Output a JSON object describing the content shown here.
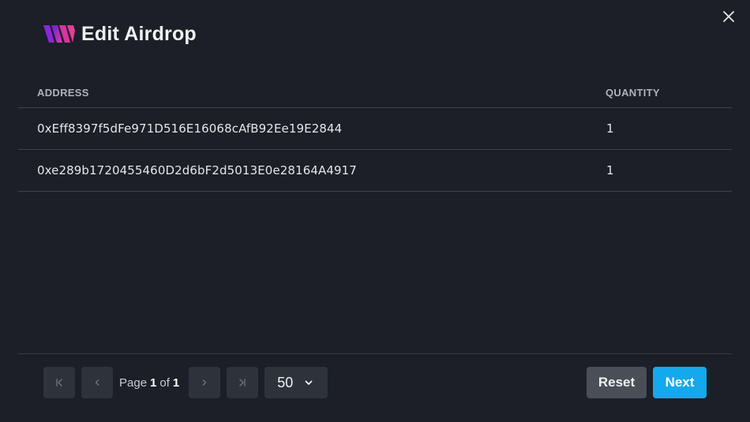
{
  "dialog": {
    "title": "Edit Airdrop",
    "close_icon": "close-icon",
    "logo_icon": "brand-logo-icon"
  },
  "table": {
    "columns": [
      "ADDRESS",
      "QUANTITY"
    ],
    "rows": [
      {
        "address": "0xEff8397f5dFe971D516E16068cAfB92Ee19E2844",
        "quantity": "1"
      },
      {
        "address": "0xe289b1720455460D2d6bF2d5013E0e28164A4917",
        "quantity": "1"
      }
    ]
  },
  "pagination": {
    "page_prefix": "Page",
    "current_page": "1",
    "of_label": "of",
    "total_pages": "1",
    "page_size": "50",
    "icons": [
      "first-page-icon",
      "prev-page-icon",
      "next-page-icon",
      "last-page-icon",
      "chevron-down-icon"
    ]
  },
  "actions": {
    "reset_label": "Reset",
    "next_label": "Next"
  },
  "colors": {
    "background": "#1c1f27",
    "accent": "#14a8ec",
    "logo_gradient": [
      "#6a1fd6",
      "#e03aa8"
    ]
  }
}
